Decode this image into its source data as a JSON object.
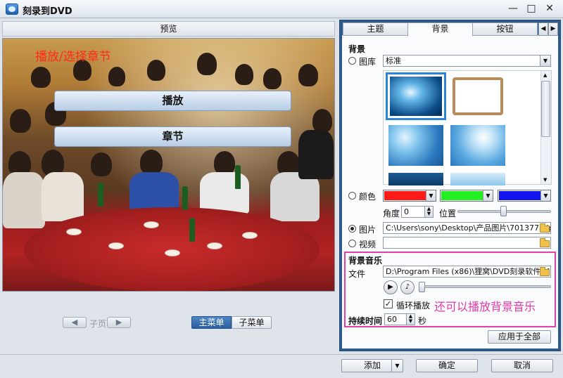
{
  "window": {
    "title": "刻录到DVD",
    "minimize": "—",
    "maximize": "□",
    "close": "✕"
  },
  "preview": {
    "header": "预览",
    "overlay_caption": "播放/选择章节",
    "menu_buttons": [
      "播放",
      "章节"
    ],
    "pager": {
      "prev": "◀",
      "label": "子页",
      "next": "▶"
    },
    "menu_tabs": [
      "主菜单",
      "子菜单"
    ]
  },
  "right": {
    "tabs": [
      "主题",
      "背景",
      "按钮"
    ],
    "tab_arrow_left": "◀",
    "tab_arrow_right": "▶",
    "background": {
      "section_title": "背景",
      "library_label": "图库",
      "library_value": "标准",
      "color_label": "颜色",
      "colors": [
        "#ff1a1a",
        "#22ee22",
        "#1414ee"
      ],
      "angle_label": "角度",
      "angle_value": "0",
      "position_label": "位置",
      "image_label": "图片",
      "image_path": "C:\\Users\\sony\\Desktop\\产品图片\\7013778.jpg",
      "video_label": "视频",
      "video_path": ""
    },
    "music": {
      "section_title": "背景音乐",
      "file_label": "文件",
      "file_path": "D:\\Program Files (x86)\\狸窝\\DVD刻录软件\\Music\\",
      "loop_label": "循环播放",
      "loop_checked": "✓",
      "duration_label": "持续时间",
      "duration_value": "60",
      "duration_unit": "秒",
      "caption": "还可以播放背景音乐"
    },
    "apply_all": "应用于全部"
  },
  "footer": {
    "add": "添加",
    "ok": "确定",
    "cancel": "取消"
  }
}
